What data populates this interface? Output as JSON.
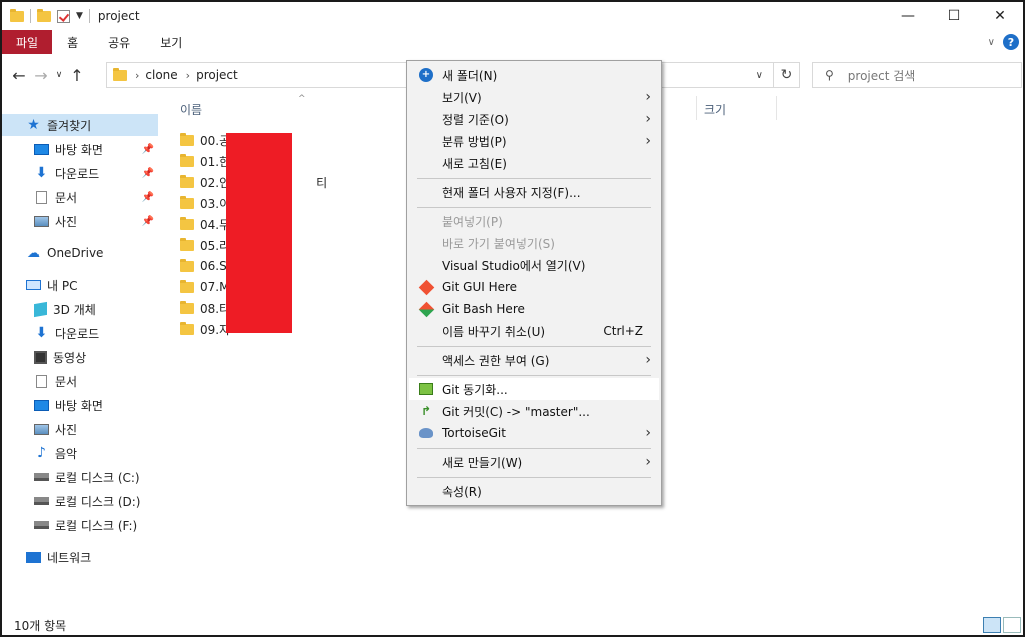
{
  "window": {
    "title": "project"
  },
  "ribbon": {
    "tabs": [
      "파일",
      "홈",
      "공유",
      "보기"
    ],
    "help": "?"
  },
  "address": {
    "crumbs": [
      "clone",
      "project"
    ],
    "search_placeholder": "project 검색"
  },
  "nav": {
    "quick_access": "즐겨찾기",
    "quick_items": [
      "바탕 화면",
      "다운로드",
      "문서",
      "사진"
    ],
    "onedrive": "OneDrive",
    "this_pc": "내 PC",
    "pc_items": [
      "3D 개체",
      "다운로드",
      "동영상",
      "문서",
      "바탕 화면",
      "사진",
      "음악",
      "로컬 디스크 (C:)",
      "로컬 디스크 (D:)",
      "로컬 디스크 (F:)"
    ],
    "network": "네트워크"
  },
  "files": {
    "col_name": "이름",
    "col_size": "크기",
    "items": [
      "00.공",
      "01.한",
      "02.인",
      "03.이",
      "04.무",
      "05.라",
      "06.S",
      "07.M",
      "08.타",
      "09.자"
    ],
    "item_extra": "티"
  },
  "menu": {
    "items": [
      {
        "label": "새 폴더(N)"
      },
      {
        "label": "보기(V)"
      },
      {
        "label": "정렬 기준(O)"
      },
      {
        "label": "분류 방법(P)"
      },
      {
        "label": "새로 고침(E)"
      },
      {
        "label": "현재 폴더 사용자 지정(F)..."
      },
      {
        "label": "붙여넣기(P)"
      },
      {
        "label": "바로 가기 붙여넣기(S)"
      },
      {
        "label": "Visual Studio에서 열기(V)"
      },
      {
        "label": "Git GUI Here"
      },
      {
        "label": "Git Bash Here"
      },
      {
        "label": "이름 바꾸기 취소(U)",
        "shortcut": "Ctrl+Z"
      },
      {
        "label": "액세스 권한 부여 (G)"
      },
      {
        "label": "Git 동기화..."
      },
      {
        "label": "Git 커밋(C) -> \"master\"..."
      },
      {
        "label": "TortoiseGit"
      },
      {
        "label": "새로 만들기(W)"
      },
      {
        "label": "속성(R)"
      }
    ]
  },
  "status": {
    "count": "10개 항목"
  }
}
